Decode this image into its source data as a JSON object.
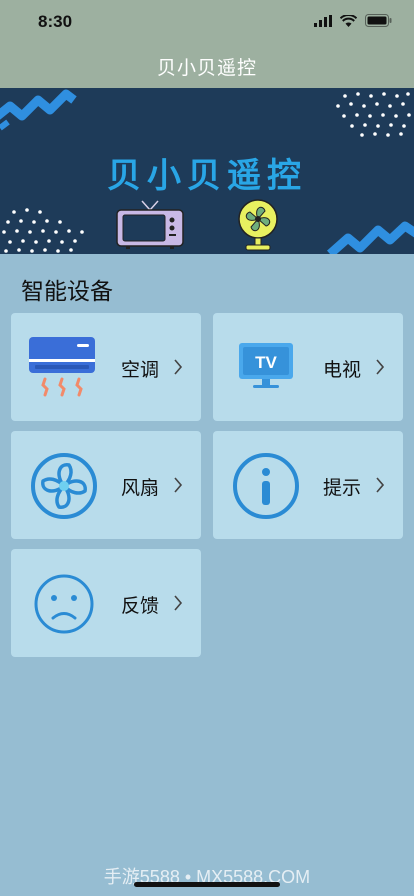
{
  "status_bar": {
    "time": "8:30"
  },
  "nav": {
    "title": "贝小贝遥控"
  },
  "banner": {
    "title": "贝小贝遥控"
  },
  "section": {
    "title": "智能设备"
  },
  "devices": [
    {
      "label": "空调",
      "icon": "air-conditioner-icon"
    },
    {
      "label": "电视",
      "icon": "tv-icon"
    },
    {
      "label": "风扇",
      "icon": "fan-icon"
    },
    {
      "label": "提示",
      "icon": "info-icon"
    },
    {
      "label": "反馈",
      "icon": "sad-face-icon"
    }
  ],
  "watermark": "手游5588 • MX5588.COM",
  "colors": {
    "header_bg": "#9db0a0",
    "page_bg": "#96bdd2",
    "card_bg": "#b8dceb",
    "banner_bg": "#1e3b59",
    "accent_blue": "#2a8bd4"
  }
}
